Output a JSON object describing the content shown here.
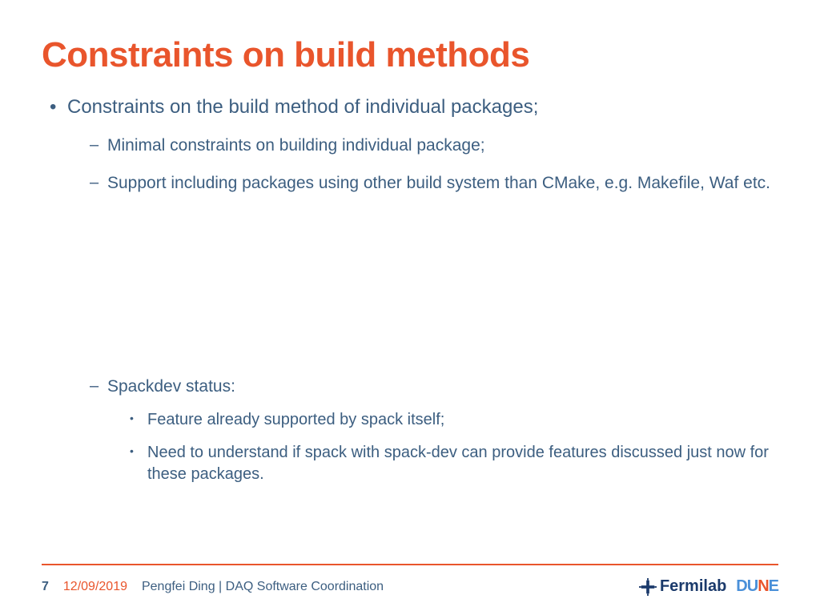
{
  "title": "Constraints on build methods",
  "bullets": {
    "b1": "Constraints on the build method of individual packages;",
    "b1_1": "Minimal constraints on building individual package;",
    "b1_2": "Support including packages using other build system than CMake, e.g. Makefile, Waf etc.",
    "b1_3": "Spackdev status:",
    "b1_3_1": "Feature already supported by spack itself;",
    "b1_3_2": "Need to understand if spack with spack-dev can provide features discussed just now for these packages."
  },
  "footer": {
    "page": "7",
    "date": "12/09/2019",
    "author": "Pengfei Ding | DAQ Software Coordination"
  },
  "logos": {
    "fermilab": "Fermilab",
    "dune_d": "D",
    "dune_u": "U",
    "dune_n": "N",
    "dune_e": "E"
  }
}
